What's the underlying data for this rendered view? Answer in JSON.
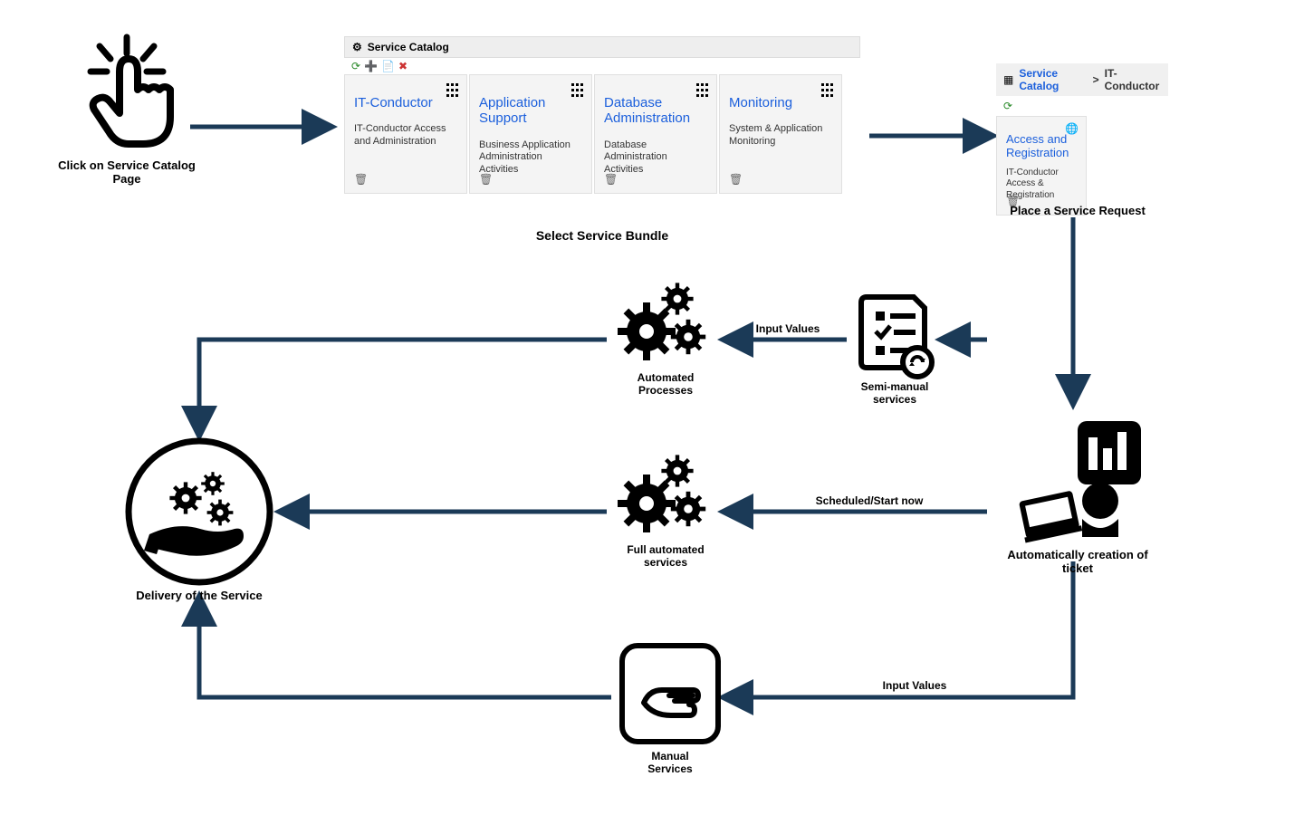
{
  "step1": {
    "caption": "Click on Service Catalog Page"
  },
  "catalog": {
    "header_title": "Service Catalog",
    "cards": [
      {
        "title": "IT-Conductor",
        "desc": "IT-Conductor Access and Administration"
      },
      {
        "title": "Application Support",
        "desc": "Business Application Administration Activities"
      },
      {
        "title": "Database Administration",
        "desc": "Database Administration Activities"
      },
      {
        "title": "Monitoring",
        "desc": "System & Application Monitoring"
      }
    ],
    "caption": "Select Service Bundle"
  },
  "breadcrumb": {
    "root": "Service Catalog",
    "sep": ">",
    "leaf": "IT-Conductor"
  },
  "request_card": {
    "title": "Access and Registration",
    "desc": "IT-Conductor Access & Registration"
  },
  "step3": {
    "caption": "Place a Service Request"
  },
  "ticket": {
    "caption": "Automatically creation of ticket"
  },
  "arrow_labels": {
    "semi_to_auto": "Input Values",
    "ticket_to_full": "Scheduled/Start now",
    "ticket_to_manual": "Input Values"
  },
  "semi": {
    "caption": "Semi-manual\nservices"
  },
  "auto_proc": {
    "caption": "Automated\nProcesses"
  },
  "full_auto": {
    "caption": "Full automated\nservices"
  },
  "manual": {
    "caption": "Manual\nServices"
  },
  "delivery": {
    "caption": "Delivery of the Service"
  }
}
